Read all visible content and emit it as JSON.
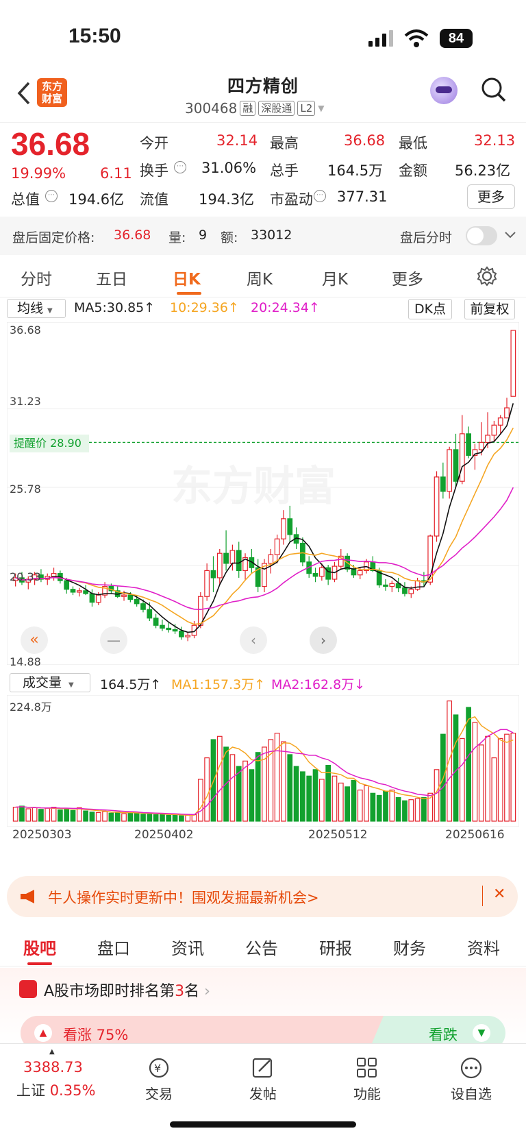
{
  "status": {
    "time": "15:50",
    "battery": "84"
  },
  "header": {
    "logo": "东方财富",
    "stock_name": "四方精创",
    "code": "300468",
    "tags": [
      "融",
      "深股通",
      "L2"
    ]
  },
  "quote": {
    "price": "36.68",
    "pct": "19.99%",
    "change": "6.11",
    "open_label": "今开",
    "open": "32.14",
    "high_label": "最高",
    "high": "36.68",
    "low_label": "最低",
    "low": "32.13",
    "turnover_label": "换手",
    "turnover": "31.06%",
    "volume_label": "总手",
    "volume": "164.5万",
    "amount_label": "金额",
    "amount": "56.23亿",
    "mcap_label": "总值",
    "mcap": "194.6亿",
    "float_label": "流值",
    "float": "194.3亿",
    "pe_label": "市盈动",
    "pe": "377.31",
    "more": "更多"
  },
  "after_hours": {
    "label": "盘后固定价格:",
    "price": "36.68",
    "vol_label": "量:",
    "vol": "9",
    "amt_label": "额:",
    "amt": "33012",
    "intraday": "盘后分时"
  },
  "tabs": [
    "分时",
    "五日",
    "日K",
    "周K",
    "月K",
    "更多"
  ],
  "active_tab": "日K",
  "kline": {
    "ma_selector": "均线",
    "ma5": "MA5:30.85↑",
    "ma10": "10:29.36↑",
    "ma20": "20:24.34↑",
    "dk": "DK点",
    "adjust": "前复权",
    "price_labels": [
      "36.68",
      "31.23",
      "25.78",
      "20.33",
      "14.88"
    ],
    "alert": "提醒价 28.90",
    "vol_selector": "成交量",
    "vol_value": "164.5万↑",
    "vol_ma1": "MA1:157.3万↑",
    "vol_ma2": "MA2:162.8万↓",
    "vol_max": "224.8万",
    "dates": [
      "20250303",
      "20250402",
      "20250512",
      "20250616"
    ],
    "watermark": "东方财富",
    "colors": {
      "up": "#e4232b",
      "down": "#12a12f",
      "ma5": "#111111",
      "ma10": "#f5a623",
      "ma20": "#e020c8"
    }
  },
  "chart_data": {
    "type": "candlestick",
    "ylim": [
      14.88,
      36.68
    ],
    "candles": [
      [
        19.3,
        19.8,
        18.9,
        19.5
      ],
      [
        19.5,
        19.9,
        19.0,
        19.2
      ],
      [
        19.2,
        19.6,
        18.7,
        19.4
      ],
      [
        19.4,
        19.9,
        19.0,
        19.7
      ],
      [
        19.7,
        20.1,
        19.2,
        19.4
      ],
      [
        19.4,
        19.8,
        19.0,
        19.6
      ],
      [
        19.6,
        20.2,
        19.3,
        19.8
      ],
      [
        19.8,
        20.0,
        19.1,
        19.3
      ],
      [
        19.3,
        19.5,
        18.4,
        18.7
      ],
      [
        18.7,
        18.9,
        18.3,
        18.5
      ],
      [
        18.5,
        18.8,
        18.2,
        18.6
      ],
      [
        18.6,
        19.0,
        18.3,
        18.4
      ],
      [
        18.4,
        18.7,
        17.5,
        17.8
      ],
      [
        17.8,
        18.5,
        17.6,
        18.3
      ],
      [
        18.3,
        19.2,
        18.1,
        18.9
      ],
      [
        18.9,
        19.1,
        18.4,
        18.6
      ],
      [
        18.6,
        18.9,
        18.1,
        18.2
      ],
      [
        18.2,
        18.6,
        17.9,
        18.3
      ],
      [
        18.3,
        18.5,
        17.8,
        18.0
      ],
      [
        18.0,
        18.3,
        17.5,
        17.7
      ],
      [
        17.7,
        18.0,
        17.1,
        17.3
      ],
      [
        17.3,
        17.8,
        16.5,
        16.7
      ],
      [
        16.7,
        17.0,
        16.0,
        16.2
      ],
      [
        16.2,
        16.6,
        15.8,
        16.0
      ],
      [
        16.0,
        16.4,
        15.7,
        15.9
      ],
      [
        15.9,
        16.3,
        15.6,
        15.8
      ],
      [
        15.8,
        16.1,
        15.2,
        15.4
      ],
      [
        15.4,
        15.7,
        15.1,
        15.5
      ],
      [
        15.5,
        16.5,
        15.3,
        16.2
      ],
      [
        16.2,
        18.5,
        16.0,
        18.2
      ],
      [
        18.2,
        20.5,
        17.9,
        20.0
      ],
      [
        20.0,
        21.0,
        18.5,
        19.5
      ],
      [
        19.5,
        21.5,
        19.0,
        21.2
      ],
      [
        21.2,
        22.8,
        20.0,
        20.5
      ],
      [
        20.5,
        21.8,
        20.0,
        21.4
      ],
      [
        21.4,
        22.0,
        19.5,
        20.0
      ],
      [
        20.0,
        21.2,
        19.3,
        20.9
      ],
      [
        20.9,
        21.5,
        19.8,
        20.2
      ],
      [
        20.2,
        20.8,
        18.5,
        18.9
      ],
      [
        18.9,
        20.8,
        18.5,
        20.5
      ],
      [
        20.5,
        21.5,
        19.8,
        21.1
      ],
      [
        21.1,
        22.5,
        20.5,
        22.2
      ],
      [
        22.2,
        24.2,
        21.8,
        23.6
      ],
      [
        23.6,
        24.5,
        22.0,
        22.5
      ],
      [
        22.5,
        23.0,
        21.5,
        21.9
      ],
      [
        21.9,
        22.3,
        20.3,
        20.6
      ],
      [
        20.6,
        21.0,
        19.5,
        19.8
      ],
      [
        19.8,
        20.2,
        19.2,
        19.6
      ],
      [
        19.6,
        20.5,
        19.3,
        20.2
      ],
      [
        20.2,
        20.4,
        19.0,
        19.4
      ],
      [
        19.4,
        20.6,
        19.2,
        20.3
      ],
      [
        20.3,
        21.5,
        20.1,
        21.0
      ],
      [
        21.0,
        21.2,
        19.9,
        20.1
      ],
      [
        20.1,
        20.4,
        19.5,
        19.7
      ],
      [
        19.7,
        20.2,
        19.4,
        20.0
      ],
      [
        20.0,
        20.8,
        19.8,
        20.6
      ],
      [
        20.6,
        21.0,
        19.9,
        20.0
      ],
      [
        20.0,
        20.2,
        18.8,
        19.0
      ],
      [
        19.0,
        19.4,
        18.6,
        18.9
      ],
      [
        18.9,
        19.3,
        18.5,
        19.1
      ],
      [
        19.1,
        19.5,
        18.5,
        18.8
      ],
      [
        18.8,
        19.2,
        18.2,
        18.4
      ],
      [
        18.4,
        18.9,
        18.1,
        18.7
      ],
      [
        18.7,
        19.5,
        18.6,
        19.3
      ],
      [
        19.3,
        19.9,
        18.9,
        19.2
      ],
      [
        19.2,
        22.5,
        19.0,
        22.4
      ],
      [
        22.4,
        26.9,
        22.0,
        26.5
      ],
      [
        26.5,
        27.5,
        25.0,
        25.5
      ],
      [
        25.5,
        28.6,
        25.0,
        28.4
      ],
      [
        28.4,
        29.5,
        25.8,
        26.2
      ],
      [
        26.2,
        30.8,
        26.0,
        29.5
      ],
      [
        29.5,
        30.0,
        27.8,
        28.0
      ],
      [
        28.0,
        28.8,
        27.0,
        28.4
      ],
      [
        28.4,
        30.3,
        28.0,
        28.9
      ],
      [
        28.9,
        31.0,
        28.5,
        29.4
      ],
      [
        29.4,
        30.4,
        29.0,
        30.1
      ],
      [
        30.1,
        30.8,
        29.5,
        30.6
      ],
      [
        30.6,
        32.0,
        32.1,
        31.3
      ],
      [
        32.1,
        36.68,
        32.1,
        36.68
      ]
    ],
    "volume_max": 224.8,
    "volume": [
      26,
      28,
      23,
      25,
      22,
      24,
      26,
      21,
      23,
      20,
      25,
      19,
      17,
      16,
      18,
      15,
      17,
      14,
      16,
      15,
      13,
      14,
      12,
      13,
      11,
      12,
      10,
      11,
      12,
      78,
      118,
      152,
      158,
      138,
      124,
      102,
      112,
      96,
      128,
      138,
      152,
      164,
      148,
      124,
      102,
      92,
      84,
      96,
      78,
      104,
      84,
      71,
      64,
      76,
      58,
      66,
      52,
      48,
      56,
      58,
      44,
      38,
      40,
      42,
      44,
      52,
      96,
      162,
      224,
      198,
      154,
      212,
      184,
      142,
      158,
      118,
      154,
      162,
      164
    ]
  }
}
